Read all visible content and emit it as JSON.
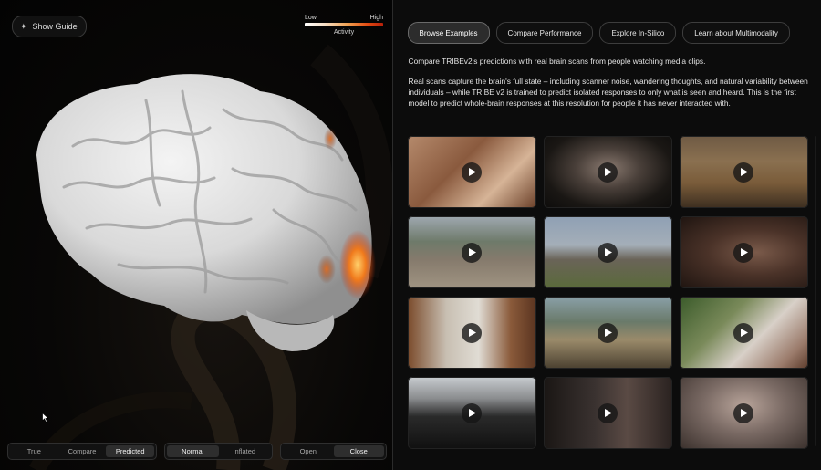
{
  "left": {
    "show_guide_label": "Show Guide",
    "show_guide_icon": "sparkle-icon",
    "legend": {
      "low": "Low",
      "high": "High",
      "title": "Activity"
    },
    "view_modes": [
      {
        "label": "True",
        "active": false
      },
      {
        "label": "Compare",
        "active": false
      },
      {
        "label": "Predicted",
        "active": true
      }
    ],
    "surface_modes": [
      {
        "label": "Normal",
        "active": true
      },
      {
        "label": "Inflated",
        "active": false
      }
    ],
    "mouth_modes": [
      {
        "label": "Open",
        "active": false
      },
      {
        "label": "Close",
        "active": true
      }
    ]
  },
  "right": {
    "tabs": [
      {
        "label": "Browse Examples",
        "active": true
      },
      {
        "label": "Compare Performance",
        "active": false
      },
      {
        "label": "Explore In-Silico",
        "active": false
      },
      {
        "label": "Learn about Multimodality",
        "active": false
      }
    ],
    "intro_p1": "Compare TRIBEv2's predictions with real brain scans from people watching media clips.",
    "intro_p2": "Real scans capture the brain's full state – including scanner noise, wandering thoughts, and natural variability between individuals – while TRIBE v2 is trained to predict isolated responses to only what is seen and heard. This is the first model to predict whole-brain responses at this resolution for people it has never interacted with.",
    "play_icon": "play-icon"
  },
  "colors": {
    "background": "#000000",
    "panel": "#0c0c0c",
    "active_tab": "#2c2c2c",
    "activity_high": "#e24b12"
  }
}
